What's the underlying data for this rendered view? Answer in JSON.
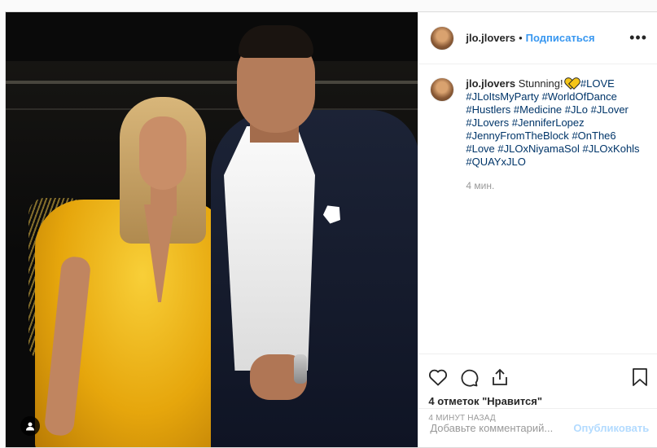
{
  "post": {
    "username": "jlo.jlovers",
    "follow_label": "Подписаться",
    "dot": "•",
    "more": "•••"
  },
  "caption": {
    "username": "jlo.jlovers",
    "text": "Stunning!",
    "emoji": "yellow-heart",
    "hashtags": [
      "#LOVE",
      "#JLoItsMyParty",
      "#WorldOfDance",
      "#Hustlers",
      "#Medicine",
      "#JLo",
      "#JLover",
      "#JLovers",
      "#JenniferLopez",
      "#JennyFromTheBlock",
      "#OnThe6",
      "#Love",
      "#JLOxNiyamaSol",
      "#JLOxKohls",
      "#QUAYxJLO"
    ],
    "time": "4 мин."
  },
  "actions": {
    "like_icon": "heart-outline-icon",
    "comment_icon": "comment-bubble-icon",
    "share_icon": "share-icon",
    "save_icon": "bookmark-icon",
    "likes_text": "4 отметок \"Нравится\"",
    "posted_text": "4 МИНУТ НАЗАД"
  },
  "comment": {
    "placeholder": "Добавьте комментарий...",
    "publish_label": "Опубликовать"
  },
  "colors": {
    "link_blue": "#3897f0",
    "hashtag": "#003569",
    "publish_disabled": "#b3dbff"
  }
}
